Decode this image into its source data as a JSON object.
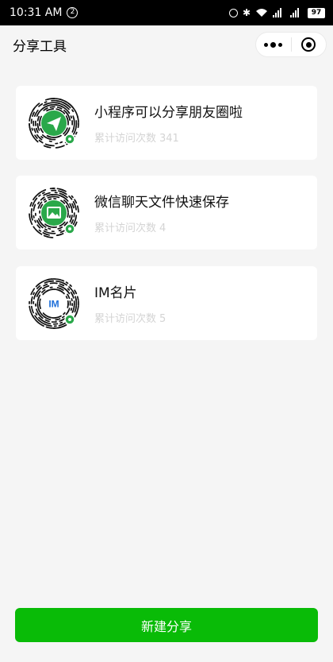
{
  "status_bar": {
    "time": "10:31 AM",
    "notification_count": "2",
    "battery": "97"
  },
  "header": {
    "title": "分享工具"
  },
  "cards": [
    {
      "title": "小程序可以分享朋友圈啦",
      "visit_label": "累计访问次数",
      "visit_count": "341",
      "qr_center_icon": "paper-plane-icon"
    },
    {
      "title": "微信聊天文件快速保存",
      "visit_label": "累计访问次数",
      "visit_count": "4",
      "qr_center_icon": "image-icon"
    },
    {
      "title": "IM名片",
      "visit_label": "累计访问次数",
      "visit_count": "5",
      "qr_center_icon": "IM"
    }
  ],
  "footer": {
    "new_share_label": "新建分享"
  },
  "colors": {
    "primary_green": "#09bb07",
    "background": "#f5f5f5",
    "subtext": "#d4d4d4",
    "qr_green": "#2aa84a",
    "im_blue": "#1e6fd9"
  }
}
